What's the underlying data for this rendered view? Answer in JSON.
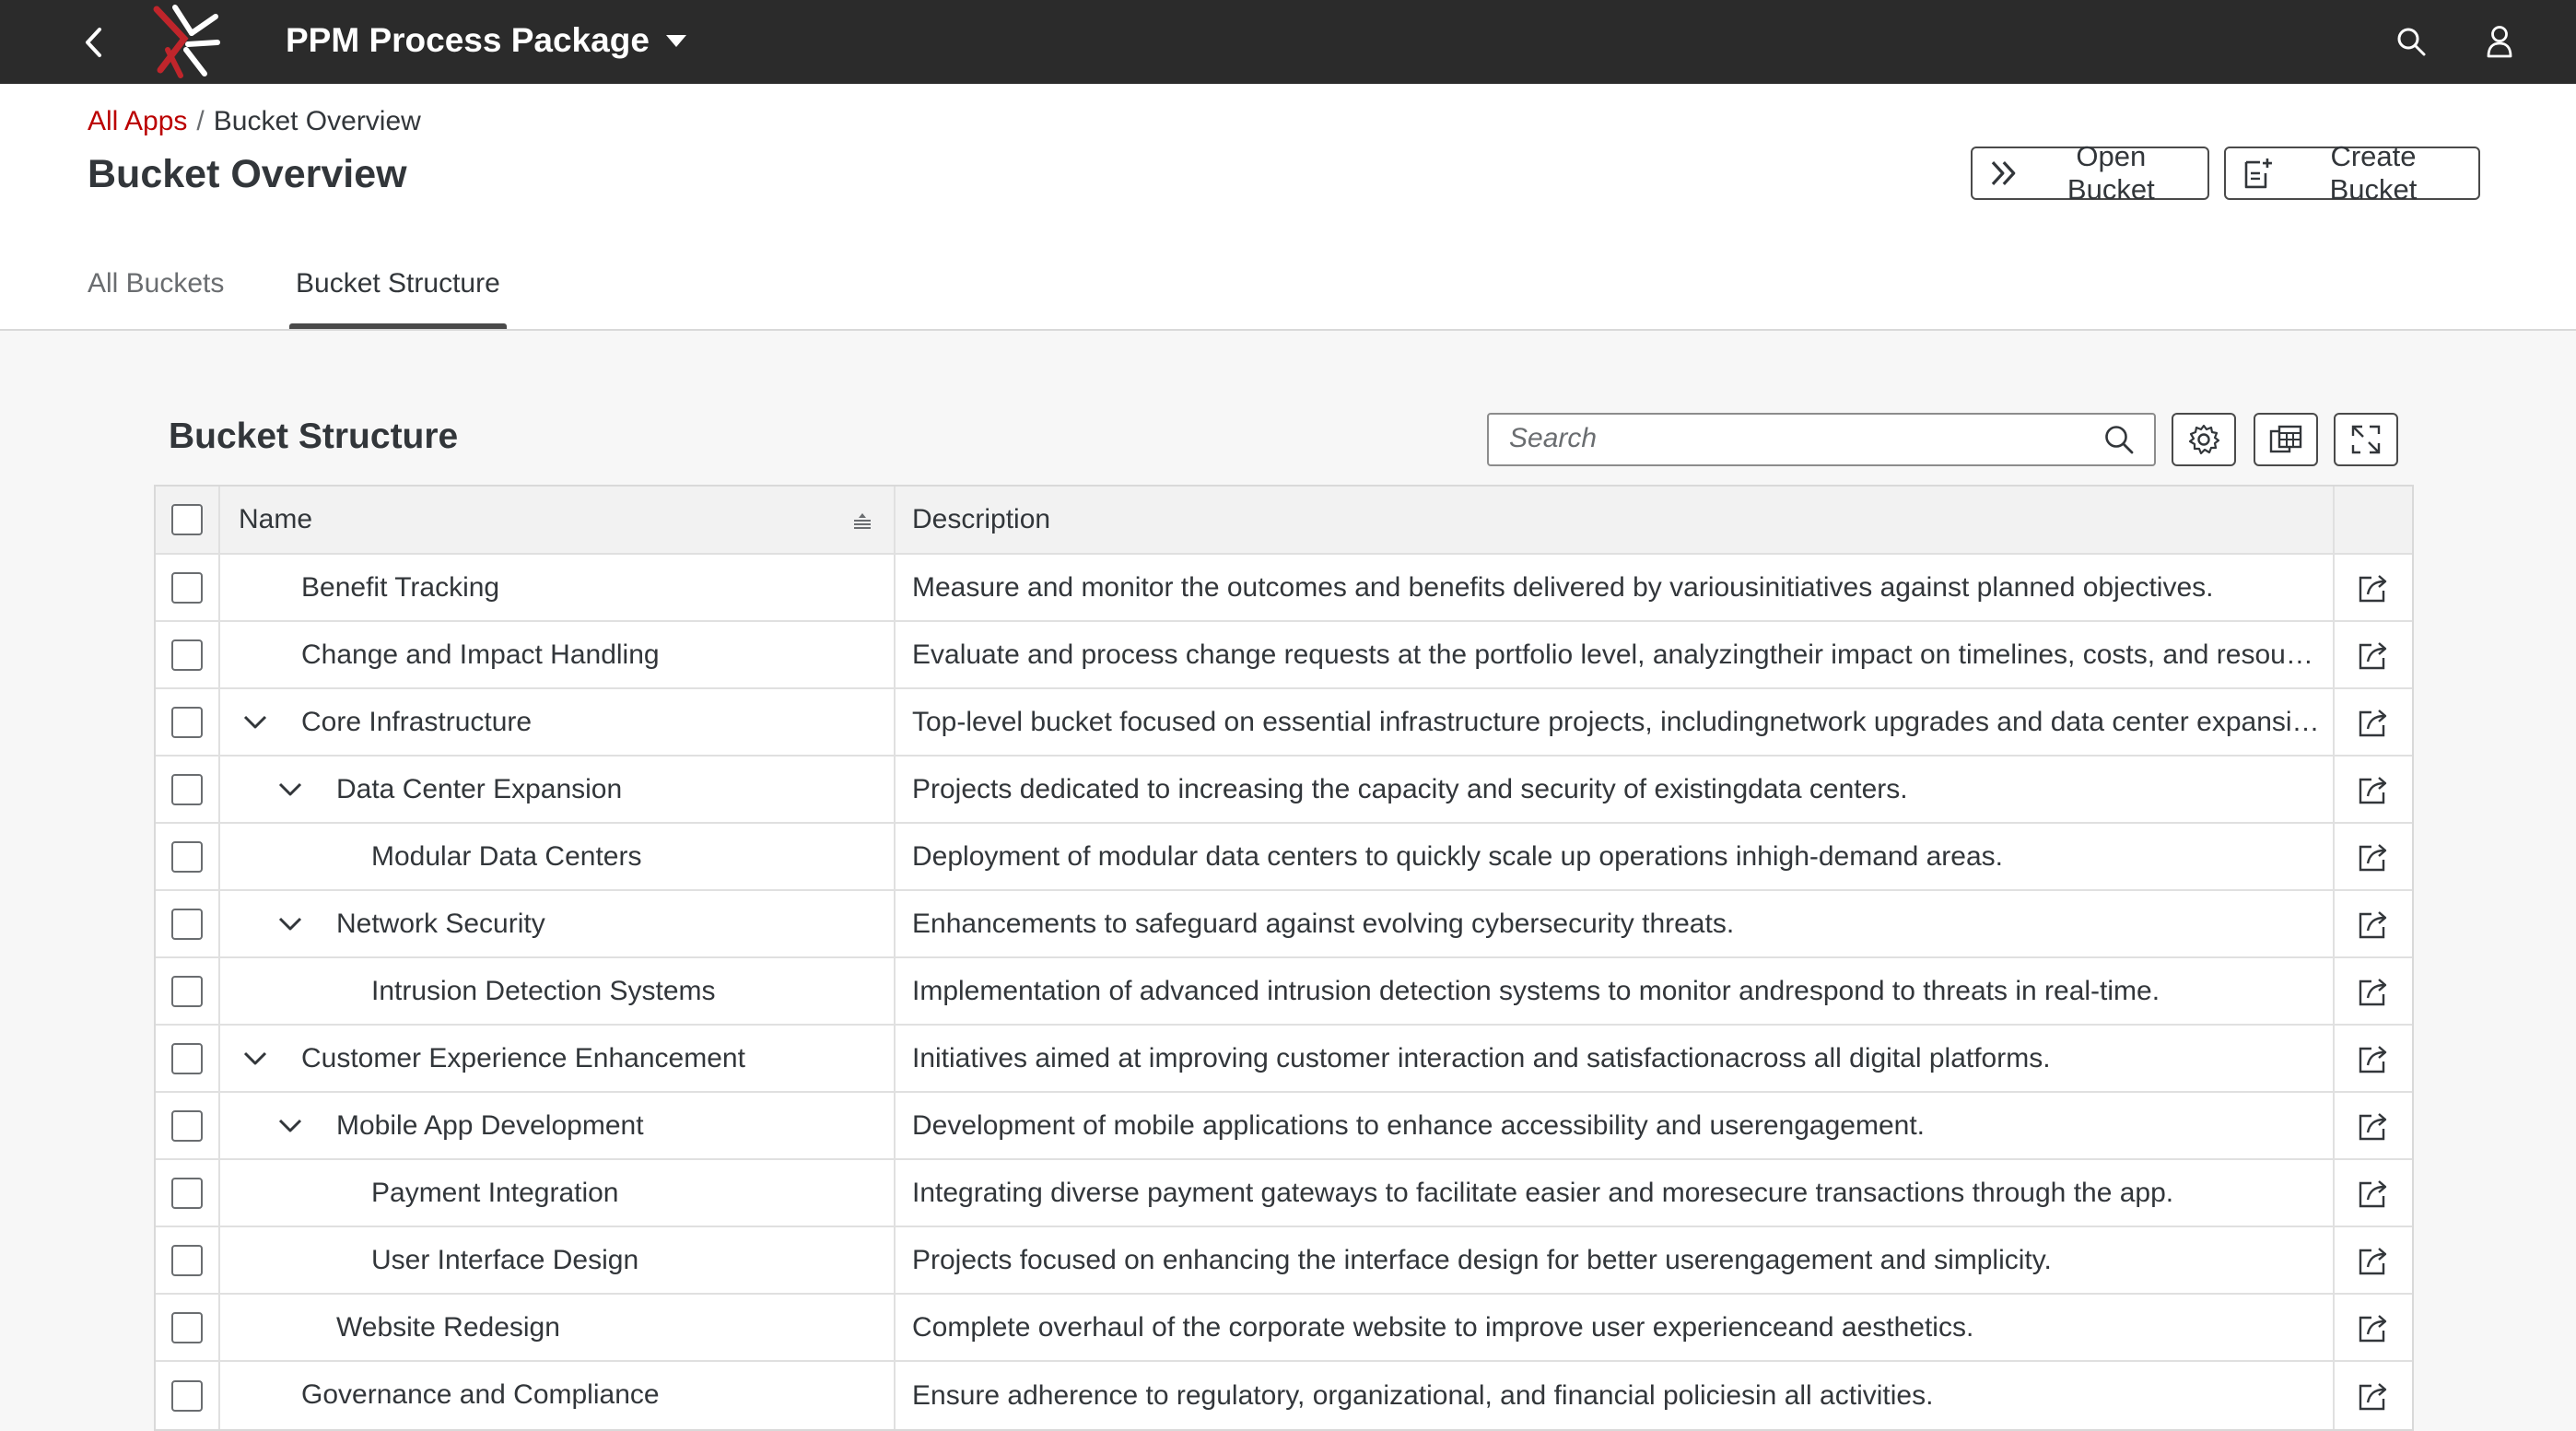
{
  "shell": {
    "title": "PPM Process Package"
  },
  "breadcrumb": {
    "root": "All Apps",
    "separator": "/",
    "current": "Bucket Overview"
  },
  "page": {
    "title": "Bucket Overview",
    "open_bucket_label": "Open Bucket",
    "create_bucket_label": "Create Bucket"
  },
  "tabs": [
    {
      "label": "All Buckets",
      "selected": false
    },
    {
      "label": "Bucket Structure",
      "selected": true
    }
  ],
  "table": {
    "title": "Bucket Structure",
    "search_placeholder": "Search",
    "columns": [
      "Name",
      "Description"
    ],
    "rows": [
      {
        "name": "Benefit Tracking",
        "level": 1,
        "expandable": false,
        "description": "Measure and monitor the outcomes and benefits delivered by variousinitiatives against planned objectives."
      },
      {
        "name": "Change and Impact Handling",
        "level": 1,
        "expandable": false,
        "description": "Evaluate and process change requests at the portfolio level, analyzingtheir impact on timelines, costs, and resources."
      },
      {
        "name": "Core Infrastructure",
        "level": 1,
        "expandable": true,
        "description": "Top-level bucket focused on essential infrastructure projects, includingnetwork upgrades and data center expansion."
      },
      {
        "name": "Data Center Expansion",
        "level": 2,
        "expandable": true,
        "description": "Projects dedicated to increasing the capacity and security of existingdata centers."
      },
      {
        "name": "Modular Data Centers",
        "level": 3,
        "expandable": false,
        "description": "Deployment of modular data centers to quickly scale up operations inhigh-demand areas."
      },
      {
        "name": "Network Security",
        "level": 2,
        "expandable": true,
        "description": "Enhancements to safeguard against evolving cybersecurity threats."
      },
      {
        "name": "Intrusion Detection Systems",
        "level": 3,
        "expandable": false,
        "description": "Implementation of advanced intrusion detection systems to monitor andrespond to threats in real-time."
      },
      {
        "name": "Customer Experience Enhancement",
        "level": 1,
        "expandable": true,
        "description": "Initiatives aimed at improving customer interaction and satisfactionacross all digital platforms."
      },
      {
        "name": "Mobile App Development",
        "level": 2,
        "expandable": true,
        "description": "Development of mobile applications to enhance accessibility and userengagement."
      },
      {
        "name": "Payment Integration",
        "level": 3,
        "expandable": false,
        "description": "Integrating diverse payment gateways to facilitate easier and moresecure transactions through the app."
      },
      {
        "name": "User Interface Design",
        "level": 3,
        "expandable": false,
        "description": "Projects focused on enhancing the interface design for better userengagement and simplicity."
      },
      {
        "name": "Website Redesign",
        "level": 2,
        "expandable": false,
        "description": "Complete overhaul of the corporate website to improve user experienceand aesthetics."
      },
      {
        "name": "Governance and Compliance",
        "level": 1,
        "expandable": false,
        "description": "Ensure adherence to regulatory, organizational, and financial policiesin all activities."
      }
    ]
  },
  "colors": {
    "shell_bg": "#2b2b2b",
    "link_red": "#bb0000",
    "logo_red": "#c0252b"
  },
  "icons": {
    "back": "chevron-left-icon",
    "search": "search-icon",
    "user": "user-icon",
    "open": "double-chevron-right-icon",
    "create": "document-add-icon",
    "settings": "gear-icon",
    "export": "spreadsheet-export-icon",
    "fullscreen": "expand-icon",
    "row_action": "external-link-icon",
    "expand": "chevron-down-icon",
    "sort": "sort-icon"
  }
}
